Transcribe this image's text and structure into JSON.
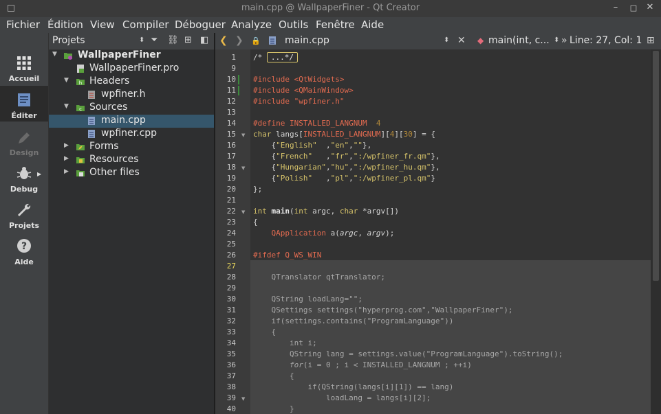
{
  "window": {
    "title": "main.cpp @ WallpaperFiner - Qt Creator",
    "min_glyph": "–",
    "max_glyph": "□",
    "close_glyph": "✕"
  },
  "menu": [
    "Fichier",
    "Édition",
    "View",
    "Compiler",
    "Déboguer",
    "Analyze",
    "Outils",
    "Fenêtre",
    "Aide"
  ],
  "modes": [
    {
      "label": "Accueil",
      "icon": "grid-icon"
    },
    {
      "label": "Éditer",
      "icon": "edit-icon",
      "active": true
    },
    {
      "label": "Design",
      "icon": "pencil-icon",
      "disabled": true
    },
    {
      "label": "Debug",
      "icon": "bug-icon"
    },
    {
      "label": "Projets",
      "icon": "wrench-icon"
    },
    {
      "label": "Aide",
      "icon": "help-icon"
    }
  ],
  "projects": {
    "header": "Projets",
    "tree": [
      {
        "label": "WallpaperFiner",
        "bold": true
      },
      {
        "label": "WallpaperFiner.pro"
      },
      {
        "label": "Headers"
      },
      {
        "label": "wpfiner.h"
      },
      {
        "label": "Sources"
      },
      {
        "label": "main.cpp",
        "selected": true
      },
      {
        "label": "wpfiner.cpp"
      },
      {
        "label": "Forms"
      },
      {
        "label": "Resources"
      },
      {
        "label": "Other files"
      }
    ]
  },
  "editor": {
    "file": "main.cpp",
    "symbol": "main(int, c...",
    "position": "Line: 27, Col: 1",
    "current_line": 27
  },
  "code": {
    "line_numbers": [
      "1",
      "9",
      "10",
      "11",
      "12",
      "13",
      "14",
      "15",
      "16",
      "17",
      "18",
      "19",
      "20",
      "21",
      "22",
      "23",
      "24",
      "25",
      "26",
      "27",
      "28",
      "29",
      "30",
      "31",
      "32",
      "33",
      "34",
      "35",
      "36",
      "37",
      "38",
      "39",
      "40"
    ],
    "l1_a": "/* ",
    "l1_fold": "...*/",
    "l10": "#include <QtWidgets>",
    "l11": "#include <QMainWindow>",
    "l12": "#include \"wpfiner.h\"",
    "l14_a": "#define INSTALLED_LANGNUM  ",
    "l14_b": "4",
    "l15_a": "char",
    "l15_b": " langs[",
    "l15_c": "INSTALLED_LANGNUM",
    "l15_d": "][",
    "l15_e": "4",
    "l15_f": "][",
    "l15_g": "30",
    "l15_h": "] = {",
    "l16_a": "    {",
    "l16_b": "\"English\"",
    "l16_c": "  ,",
    "l16_d": "\"en\"",
    "l16_e": ",",
    "l16_f": "\"\"",
    "l16_g": "},",
    "l17_a": "    {",
    "l17_b": "\"French\"",
    "l17_c": "   ,",
    "l17_d": "\"fr\"",
    "l17_e": ",",
    "l17_f": "\":/wpfiner_fr.qm\"",
    "l17_g": "},",
    "l18_a": "    {",
    "l18_b": "\"Hungarian\"",
    "l18_c": ",",
    "l18_d": "\"hu\"",
    "l18_e": ",",
    "l18_f": "\":/wpfiner_hu.qm\"",
    "l18_g": "},",
    "l19_a": "    {",
    "l19_b": "\"Polish\"",
    "l19_c": "   ,",
    "l19_d": "\"pl\"",
    "l19_e": ",",
    "l19_f": "\":/wpfiner_pl.qm\"",
    "l19_g": "}",
    "l20": "};",
    "l22_a": "int",
    "l22_b": " ",
    "l22_c": "main",
    "l22_d": "(",
    "l22_e": "int",
    "l22_f": " argc, ",
    "l22_g": "char",
    "l22_h": " *argv[])",
    "l23": "{",
    "l24_a": "    ",
    "l24_b": "QApplication",
    "l24_c": " a(",
    "l24_d": "argc",
    "l24_e": ", ",
    "l24_f": "argv",
    "l24_g": ");",
    "l26": "#ifdef Q_WS_WIN",
    "l28": "    QTranslator qtTranslator;",
    "l30": "    QString loadLang=\"\";",
    "l31": "    QSettings settings(\"hyperprog.com\",\"WallpaperFiner\");",
    "l32": "    if(settings.contains(\"ProgramLanguage\"))",
    "l33": "    {",
    "l34": "        int i;",
    "l35": "        QString lang = settings.value(\"ProgramLanguage\").toString();",
    "l36_a": "        ",
    "l36_b": "for",
    "l36_c": "(i = 0 ; i < INSTALLED_LANGNUM ; ++i)",
    "l37": "        {",
    "l38": "            if(QString(langs[i][1]) == lang)",
    "l39": "                loadLang = langs[i][2];",
    "l40": "        }"
  }
}
